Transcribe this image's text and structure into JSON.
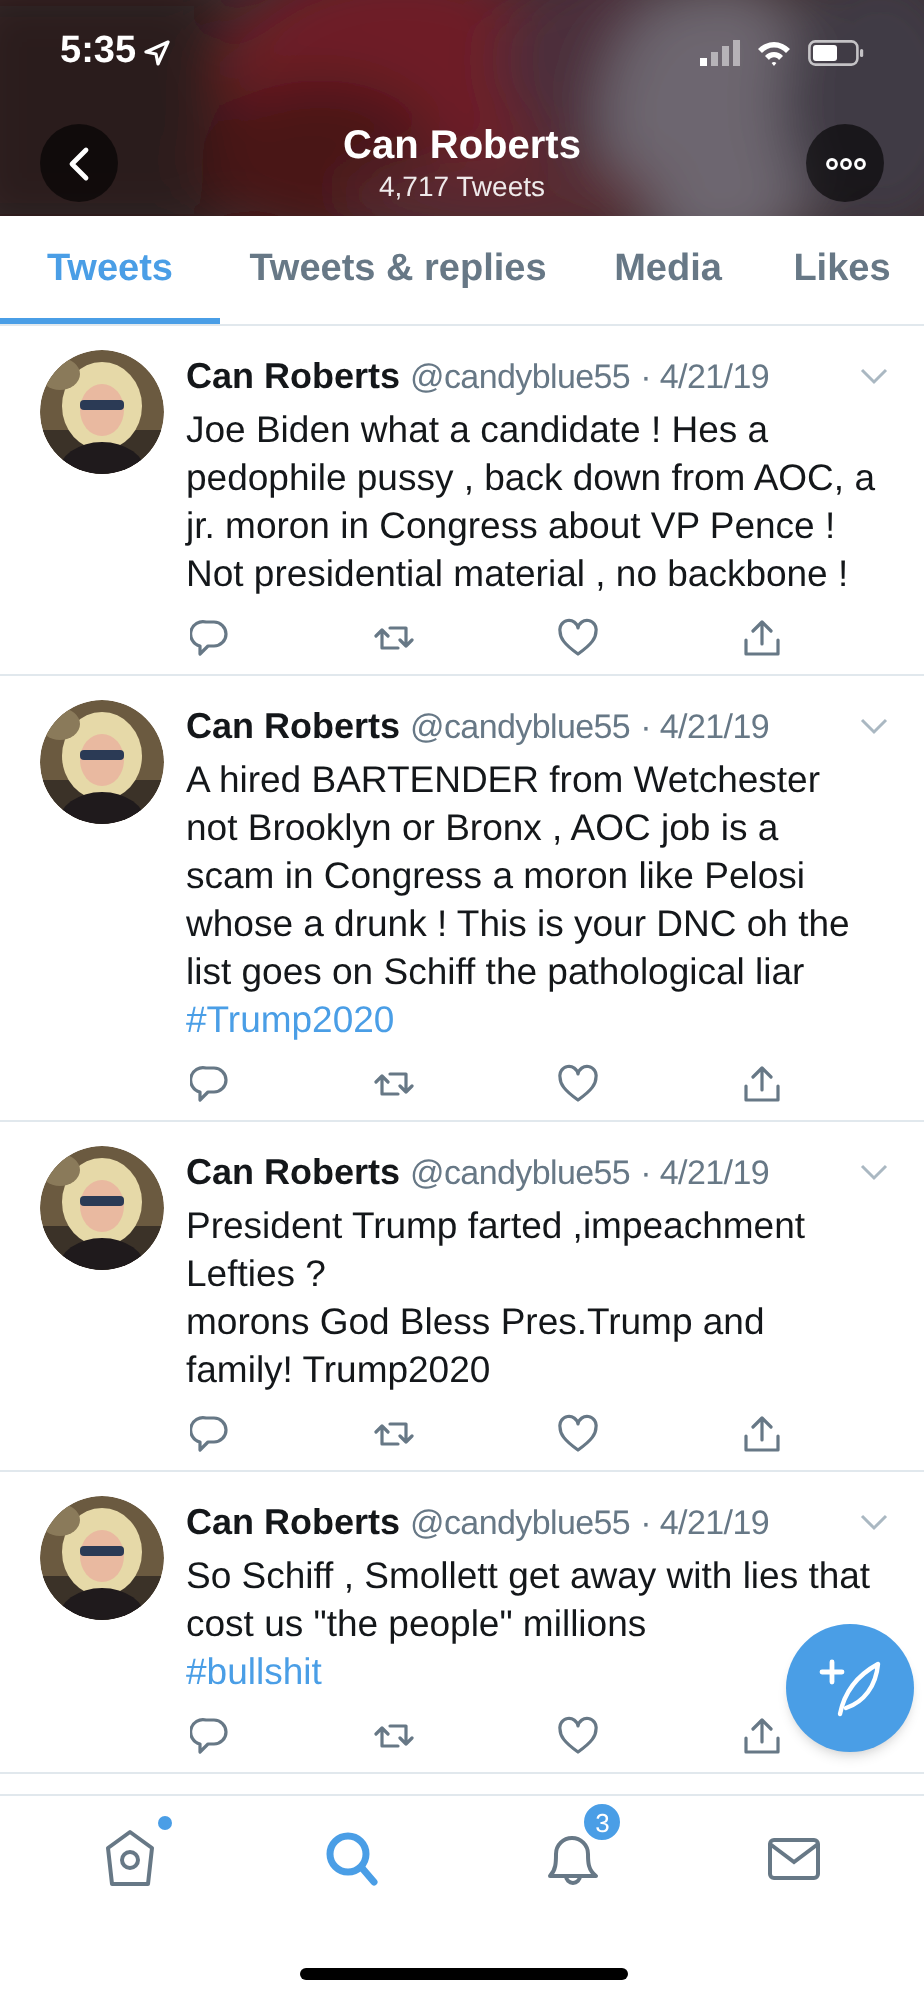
{
  "status_bar": {
    "time": "5:35"
  },
  "header": {
    "name": "Can Roberts",
    "subtitle": "4,717 Tweets"
  },
  "tabs": [
    {
      "label": "Tweets",
      "selected": true
    },
    {
      "label": "Tweets & replies",
      "selected": false
    },
    {
      "label": "Media",
      "selected": false
    },
    {
      "label": "Likes",
      "selected": false
    }
  ],
  "tweets": [
    {
      "name": "Can Roberts",
      "handle": "@candyblue55",
      "date": "· 4/21/19",
      "text": "Joe Biden what a candidate ! Hes a pedophile pussy , back down from AOC, a jr. moron in Congress about VP Pence ! Not presidential material , no backbone !"
    },
    {
      "name": "Can Roberts",
      "handle": "@candyblue55",
      "date": "· 4/21/19",
      "text": "A hired BARTENDER from Wetchester not  Brooklyn or Bronx , AOC job is a scam in Congress a moron like Pelosi whose a drunk ! This is your DNC oh the list goes on Schiff the pathological liar",
      "hashtag": "#Trump2020"
    },
    {
      "name": "Can Roberts",
      "handle": "@candyblue55",
      "date": "· 4/21/19",
      "text": "President Trump farted ,impeachment Lefties ?\n  morons God Bless Pres.Trump and family!  Trump2020"
    },
    {
      "name": "Can Roberts",
      "handle": "@candyblue55",
      "date": "· 4/21/19",
      "text": "So Schiff , Smollett get away with lies that cost us \"the people\" millions",
      "hashtag": "#bullshit"
    }
  ],
  "bottom_nav": [
    {
      "kind": "home",
      "selected": false,
      "dot": true
    },
    {
      "kind": "search",
      "selected": true
    },
    {
      "kind": "notifications",
      "selected": false,
      "badge": "3"
    },
    {
      "kind": "messages",
      "selected": false
    }
  ]
}
